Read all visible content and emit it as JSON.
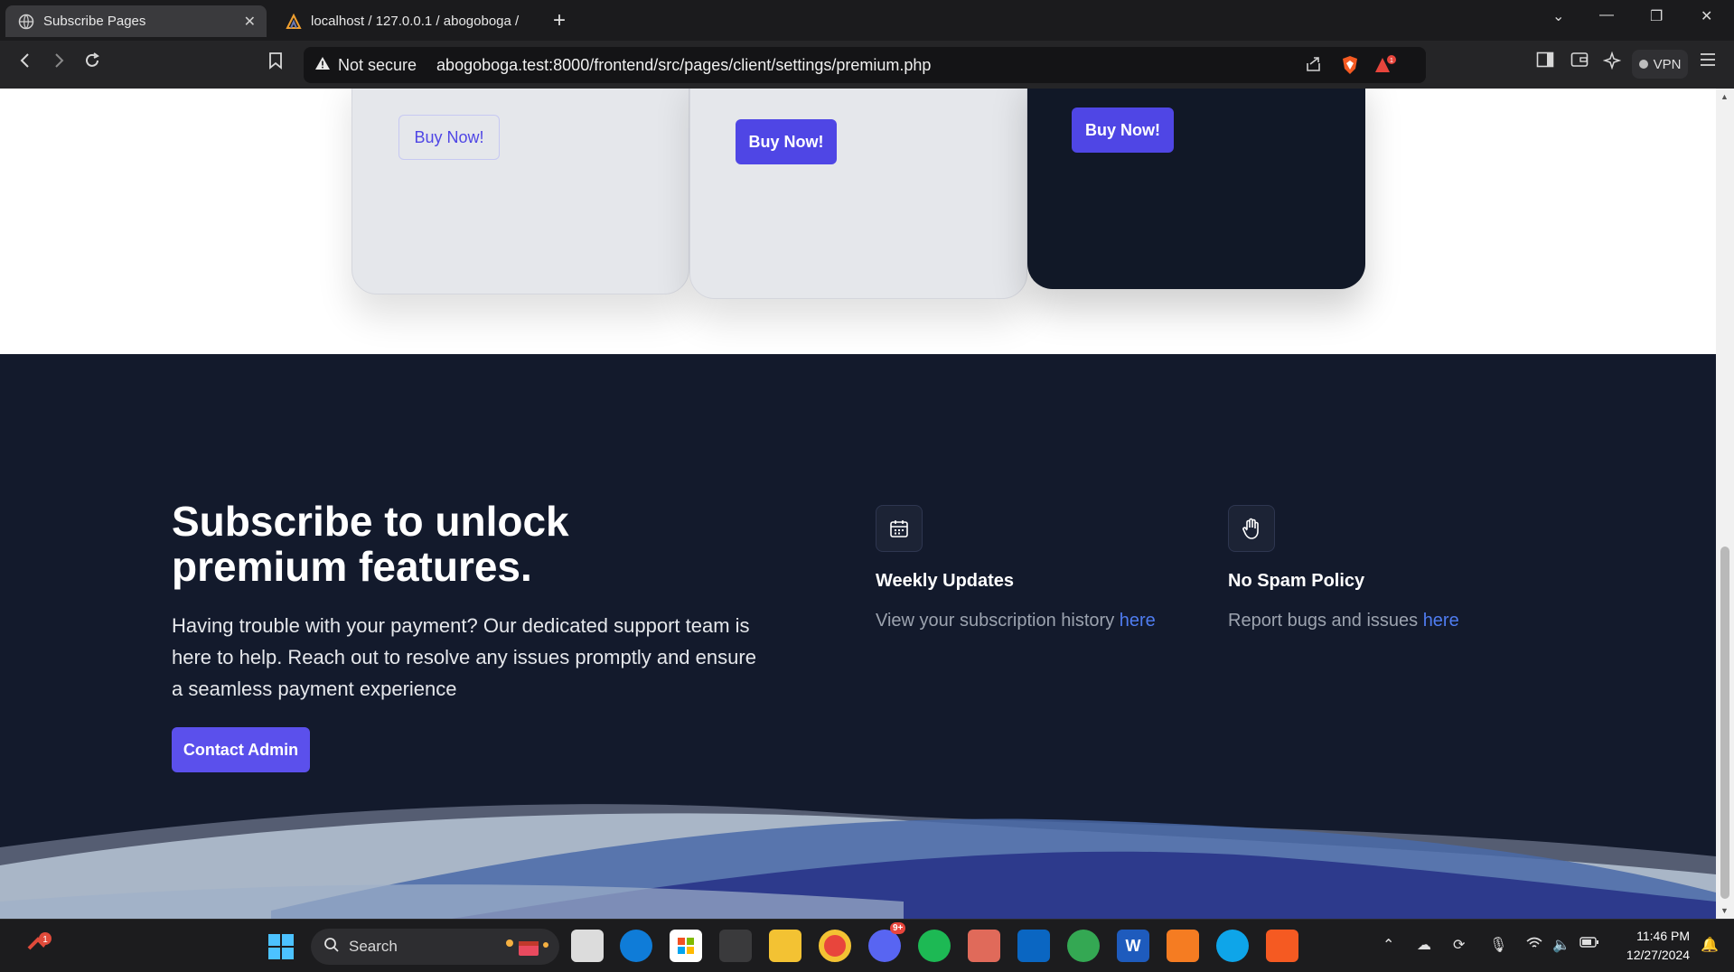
{
  "browser": {
    "tabs": [
      {
        "title": "Subscribe Pages",
        "active": true
      },
      {
        "title": "localhost / 127.0.0.1 / abogoboga /",
        "active": false
      }
    ],
    "new_tab_label": "+",
    "security_label": "Not secure",
    "url": "abogoboga.test:8000/frontend/src/pages/client/settings/premium.php",
    "vpn_label": "VPN",
    "rewards_badge": "1"
  },
  "pricing_cards": {
    "buy_labels": [
      "Buy Now!",
      "Buy Now!",
      "Buy Now!"
    ]
  },
  "footer": {
    "headline": "Subscribe to unlock premium features.",
    "lead": "Having trouble with your payment? Our dedicated support team is here to help. Reach out to resolve any issues promptly and ensure a seamless payment experience",
    "contact_button": "Contact Admin",
    "features": [
      {
        "icon": "calendar-icon",
        "title": "Weekly Updates",
        "text": "View your subscription history ",
        "link": "here"
      },
      {
        "icon": "hand-icon",
        "title": "No Spam Policy",
        "text": "Report bugs and issues ",
        "link": "here"
      }
    ]
  },
  "taskbar": {
    "search_placeholder": "Search",
    "notification_badge": "1",
    "discord_badge": "9+",
    "time": "11:46 PM",
    "date": "12/27/2024"
  },
  "colors": {
    "accent": "#4f46e5",
    "footer_bg": "#131a2c",
    "card_light": "#e5e7eb",
    "card_dark": "#111827",
    "link": "#4f7cf0"
  }
}
